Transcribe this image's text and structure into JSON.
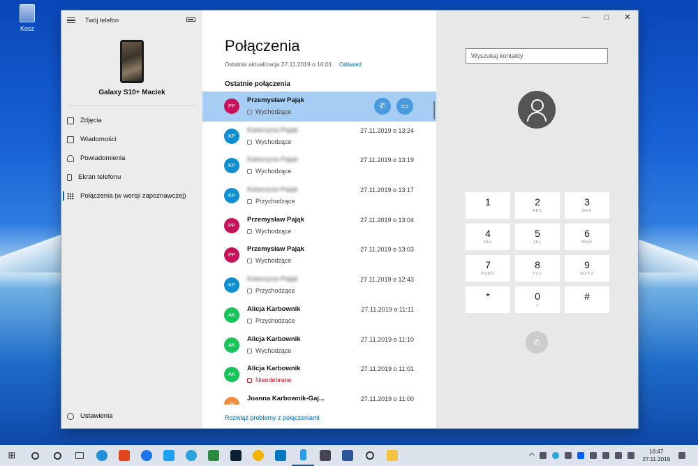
{
  "desktop": {
    "recycle_bin": "Kosz"
  },
  "sidebar": {
    "app_title": "Twój telefon",
    "device_name": "Galaxy S10+ Maciek",
    "items": [
      {
        "label": "Zdjęcia",
        "icon": "photo-icon"
      },
      {
        "label": "Wiadomości",
        "icon": "message-icon"
      },
      {
        "label": "Powiadomienia",
        "icon": "bell-icon"
      },
      {
        "label": "Ekran telefonu",
        "icon": "phone-screen-icon"
      },
      {
        "label": "Połączenia (w wersji zapoznawczej)",
        "icon": "dialpad-icon",
        "active": true
      }
    ],
    "settings": "Ustawienia"
  },
  "main": {
    "title": "Połączenia",
    "last_update": "Ostatnia aktualizacja 27.11.2019 o 16:01",
    "refresh": "Odśwież",
    "section": "Ostatnie połączenia",
    "calls": [
      {
        "initials": "PP",
        "name": "Przemysław Pająk",
        "type": "Wychodzące",
        "date": "",
        "color": "#c8115a",
        "selected": true
      },
      {
        "initials": "KP",
        "name": "Katarzyna Pająk",
        "type": "Wychodzące",
        "date": "27.11.2019 o 13:24",
        "color": "#0f8fd1",
        "blurred": true
      },
      {
        "initials": "KP",
        "name": "Katarzyna Pająk",
        "type": "Wychodzące",
        "date": "27.11.2019 o 13:19",
        "color": "#0f8fd1",
        "blurred": true
      },
      {
        "initials": "KP",
        "name": "Katarzyna Pająk",
        "type": "Przychodzące",
        "date": "27.11.2019 o 13:17",
        "color": "#0f8fd1",
        "blurred": true
      },
      {
        "initials": "PP",
        "name": "Przemysław Pająk",
        "type": "Wychodzące",
        "date": "27.11.2019 o 13:04",
        "color": "#c8115a"
      },
      {
        "initials": "PP",
        "name": "Przemysław Pająk",
        "type": "Wychodzące",
        "date": "27.11.2019 o 13:03",
        "color": "#c8115a"
      },
      {
        "initials": "KP",
        "name": "Katarzyna Pająk",
        "type": "Przychodzące",
        "date": "27.11.2019 o 12:43",
        "color": "#0f8fd1",
        "blurred": true
      },
      {
        "initials": "AK",
        "name": "Alicja Karbownik",
        "type": "Przychodzące",
        "date": "27.11.2019 o 11:11",
        "color": "#16c45a"
      },
      {
        "initials": "AK",
        "name": "Alicja Karbownik",
        "type": "Wychodzące",
        "date": "27.11.2019 o 11:10",
        "color": "#16c45a"
      },
      {
        "initials": "AK",
        "name": "Alicja Karbownik",
        "type": "Nieodebrane",
        "date": "27.11.2019 o 11:01",
        "color": "#16c45a",
        "missed": true
      },
      {
        "initials": "JK",
        "name": "Joanna Karbownik-Gaj...",
        "type": "",
        "date": "27.11.2019 o 11:00",
        "color": "#f08c3a"
      }
    ],
    "troubleshoot": "Rozwiąż problemy z połączeniami"
  },
  "dialer": {
    "search_placeholder": "Wyszukaj kontakty",
    "keys": [
      {
        "digit": "1",
        "letters": ""
      },
      {
        "digit": "2",
        "letters": "ABC"
      },
      {
        "digit": "3",
        "letters": "DEF"
      },
      {
        "digit": "4",
        "letters": "GHI"
      },
      {
        "digit": "5",
        "letters": "JKL"
      },
      {
        "digit": "6",
        "letters": "MNO"
      },
      {
        "digit": "7",
        "letters": "PQRS"
      },
      {
        "digit": "8",
        "letters": "TUV"
      },
      {
        "digit": "9",
        "letters": "WXYZ"
      },
      {
        "digit": "*",
        "letters": ""
      },
      {
        "digit": "0",
        "letters": "+"
      },
      {
        "digit": "#",
        "letters": ""
      }
    ]
  },
  "taskbar": {
    "time": "16:47",
    "date": "27.11.2019"
  }
}
